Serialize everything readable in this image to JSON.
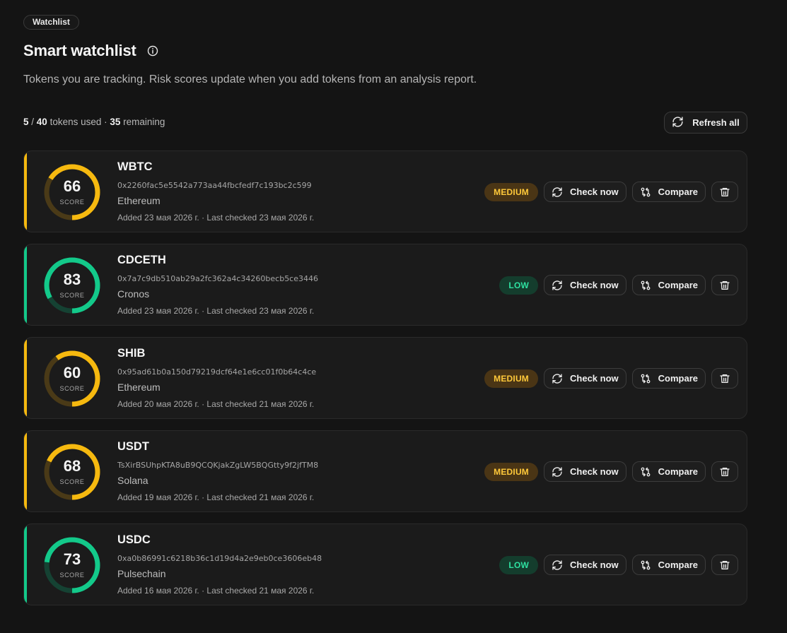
{
  "breadcrumb": "Watchlist",
  "title": "Smart watchlist",
  "subtitle": "Tokens you are tracking. Risk scores update when you add tokens from an analysis report.",
  "usage": {
    "used": "5",
    "separator": " / ",
    "limit": "40",
    "used_text": " tokens used · ",
    "remaining": "35",
    "remaining_text": " remaining"
  },
  "refresh_all_label": "Refresh all",
  "score_label": "SCORE",
  "check_now_label": "Check now",
  "compare_label": "Compare",
  "colors": {
    "medium": "#f6b90f",
    "low": "#13c98a",
    "medium_track": "#4a3a17",
    "low_track": "#154233"
  },
  "tokens": [
    {
      "symbol": "WBTC",
      "score": 66,
      "risk": "MEDIUM",
      "address": "0x2260fac5e5542a773aa44fbcfedf7c193bc2c599",
      "chain": "Ethereum",
      "dates": "Added 23 мая 2026 г. · Last checked 23 мая 2026 г."
    },
    {
      "symbol": "CDCETH",
      "score": 83,
      "risk": "LOW",
      "address": "0x7a7c9db510ab29a2fc362a4c34260becb5ce3446",
      "chain": "Cronos",
      "dates": "Added 23 мая 2026 г. · Last checked 23 мая 2026 г."
    },
    {
      "symbol": "SHIB",
      "score": 60,
      "risk": "MEDIUM",
      "address": "0x95ad61b0a150d79219dcf64e1e6cc01f0b64c4ce",
      "chain": "Ethereum",
      "dates": "Added 20 мая 2026 г. · Last checked 21 мая 2026 г."
    },
    {
      "symbol": "USDT",
      "score": 68,
      "risk": "MEDIUM",
      "address": "TsXirBSUhpKTA8uB9QCQKjakZgLW5BQGtty9f2jfTM8",
      "chain": "Solana",
      "dates": "Added 19 мая 2026 г. · Last checked 21 мая 2026 г."
    },
    {
      "symbol": "USDC",
      "score": 73,
      "risk": "LOW",
      "address": "0xa0b86991c6218b36c1d19d4a2e9eb0ce3606eb48",
      "chain": "Pulsechain",
      "dates": "Added 16 мая 2026 г. · Last checked 21 мая 2026 г."
    }
  ]
}
